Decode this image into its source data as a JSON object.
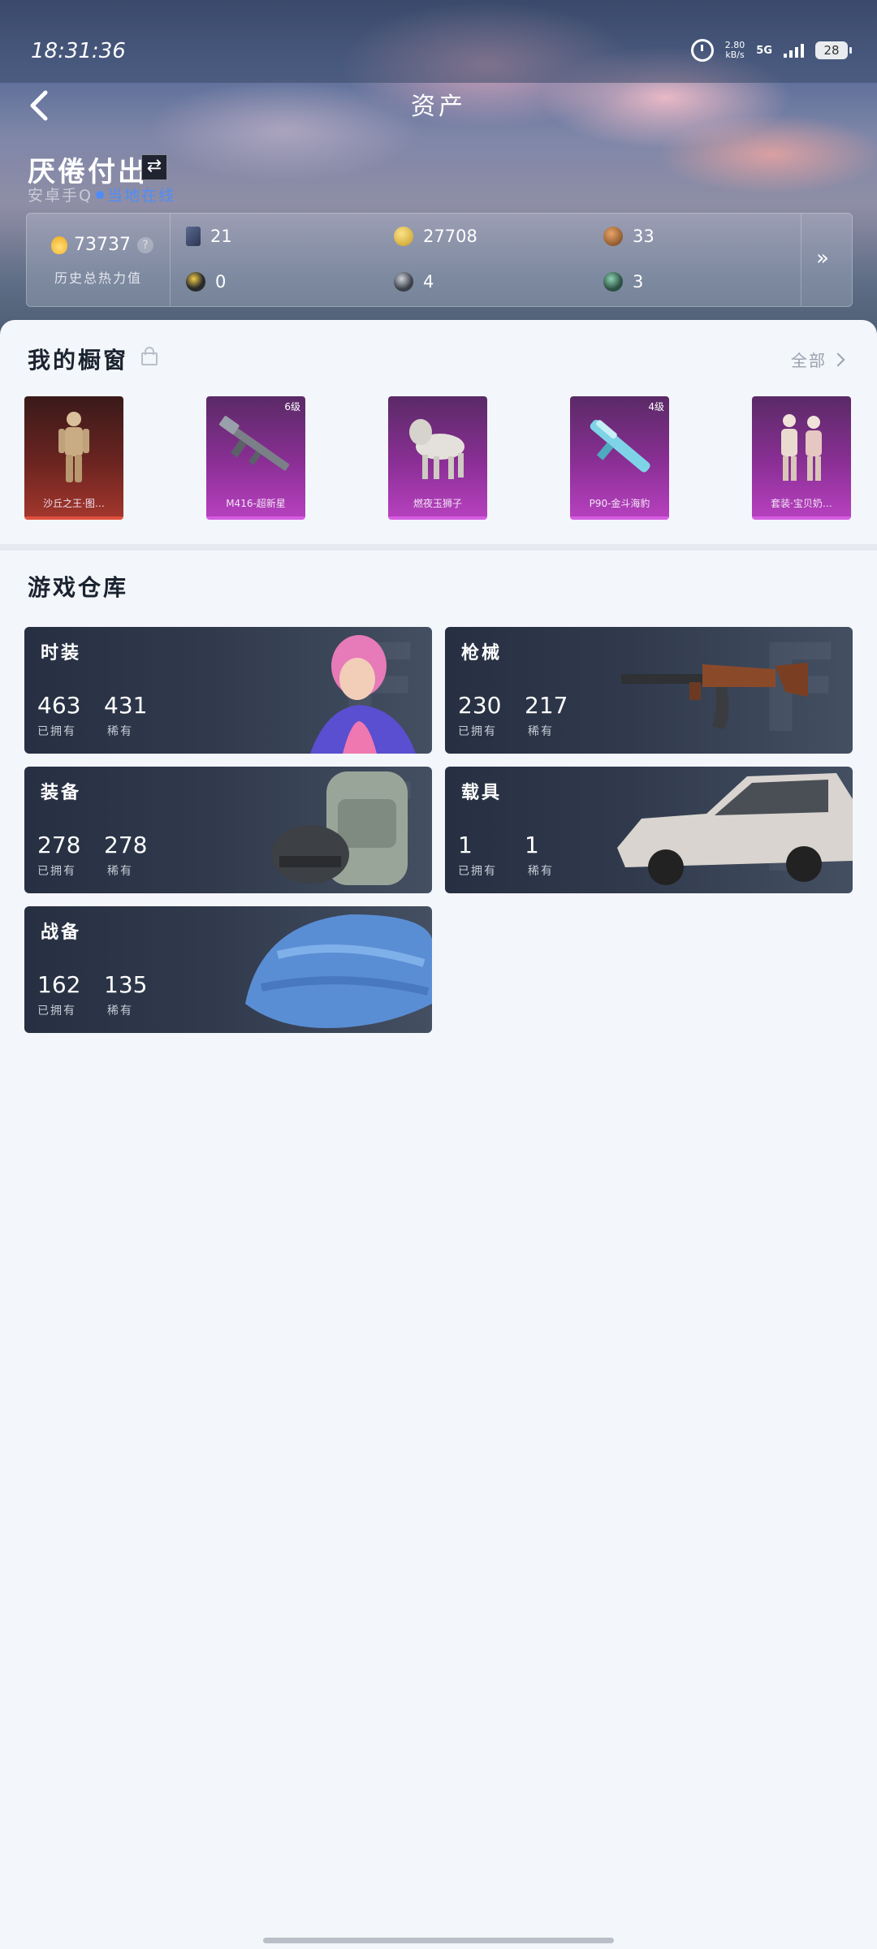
{
  "status_bar": {
    "time": "18:31:36",
    "net_speed_value": "2.80",
    "net_speed_unit": "kB/s",
    "network": "5G",
    "battery": "28"
  },
  "header": {
    "title": "资产"
  },
  "player": {
    "name": "厌倦付出",
    "platform": "安卓手Q",
    "status": "当地在线"
  },
  "stats": {
    "power_value": "73737",
    "power_label": "历史总热力值",
    "items": [
      {
        "icon": "book-icon",
        "value": "21"
      },
      {
        "icon": "gold-coin-icon",
        "value": "27708"
      },
      {
        "icon": "bronze-coin-icon",
        "value": "33"
      },
      {
        "icon": "token-icon",
        "value": "0"
      },
      {
        "icon": "silver-coin-icon",
        "value": "4"
      },
      {
        "icon": "green-coin-icon",
        "value": "3"
      }
    ]
  },
  "showcase": {
    "title": "我的橱窗",
    "view_all": "全部",
    "items": [
      {
        "label": "沙丘之王·图…",
        "level": "",
        "rarity": "red"
      },
      {
        "label": "M416-超新星",
        "level": "6级",
        "rarity": "purple"
      },
      {
        "label": "燃夜玉狮子",
        "level": "",
        "rarity": "purple"
      },
      {
        "label": "P90-金斗海豹",
        "level": "4级",
        "rarity": "purple"
      },
      {
        "label": "套装·宝贝奶…",
        "level": "",
        "rarity": "purple"
      }
    ]
  },
  "warehouse": {
    "title": "游戏仓库",
    "owned_label": "已拥有",
    "rare_label": "稀有",
    "categories": [
      {
        "name": "时装",
        "owned": "463",
        "rare": "431"
      },
      {
        "name": "枪械",
        "owned": "230",
        "rare": "217"
      },
      {
        "name": "装备",
        "owned": "278",
        "rare": "278"
      },
      {
        "name": "载具",
        "owned": "1",
        "rare": "1"
      },
      {
        "name": "战备",
        "owned": "162",
        "rare": "135"
      }
    ]
  }
}
